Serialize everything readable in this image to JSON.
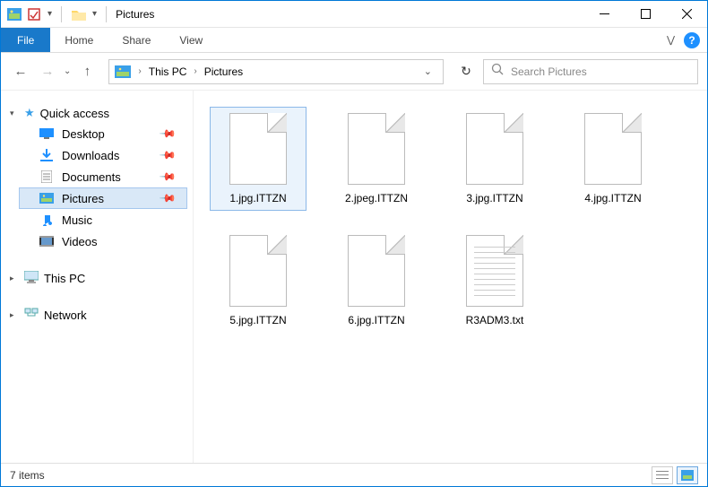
{
  "window": {
    "title": "Pictures"
  },
  "ribbon": {
    "file": "File",
    "tabs": [
      "Home",
      "Share",
      "View"
    ]
  },
  "breadcrumb": {
    "root": "This PC",
    "current": "Pictures"
  },
  "search": {
    "placeholder": "Search Pictures"
  },
  "nav": {
    "quick_access": {
      "label": "Quick access",
      "items": [
        {
          "label": "Desktop",
          "icon": "desktop",
          "pinned": true
        },
        {
          "label": "Downloads",
          "icon": "downloads",
          "pinned": true
        },
        {
          "label": "Documents",
          "icon": "documents",
          "pinned": true
        },
        {
          "label": "Pictures",
          "icon": "pictures",
          "pinned": true,
          "selected": true
        },
        {
          "label": "Music",
          "icon": "music",
          "pinned": false
        },
        {
          "label": "Videos",
          "icon": "videos",
          "pinned": false
        }
      ]
    },
    "this_pc": {
      "label": "This PC"
    },
    "network": {
      "label": "Network"
    }
  },
  "files": [
    {
      "name": "1.jpg.ITTZN",
      "type": "file",
      "selected": true
    },
    {
      "name": "2.jpeg.ITTZN",
      "type": "file"
    },
    {
      "name": "3.jpg.ITTZN",
      "type": "file"
    },
    {
      "name": "4.jpg.ITTZN",
      "type": "file"
    },
    {
      "name": "5.jpg.ITTZN",
      "type": "file"
    },
    {
      "name": "6.jpg.ITTZN",
      "type": "file"
    },
    {
      "name": "R3ADM3.txt",
      "type": "text"
    }
  ],
  "status": {
    "count_label": "7 items"
  }
}
